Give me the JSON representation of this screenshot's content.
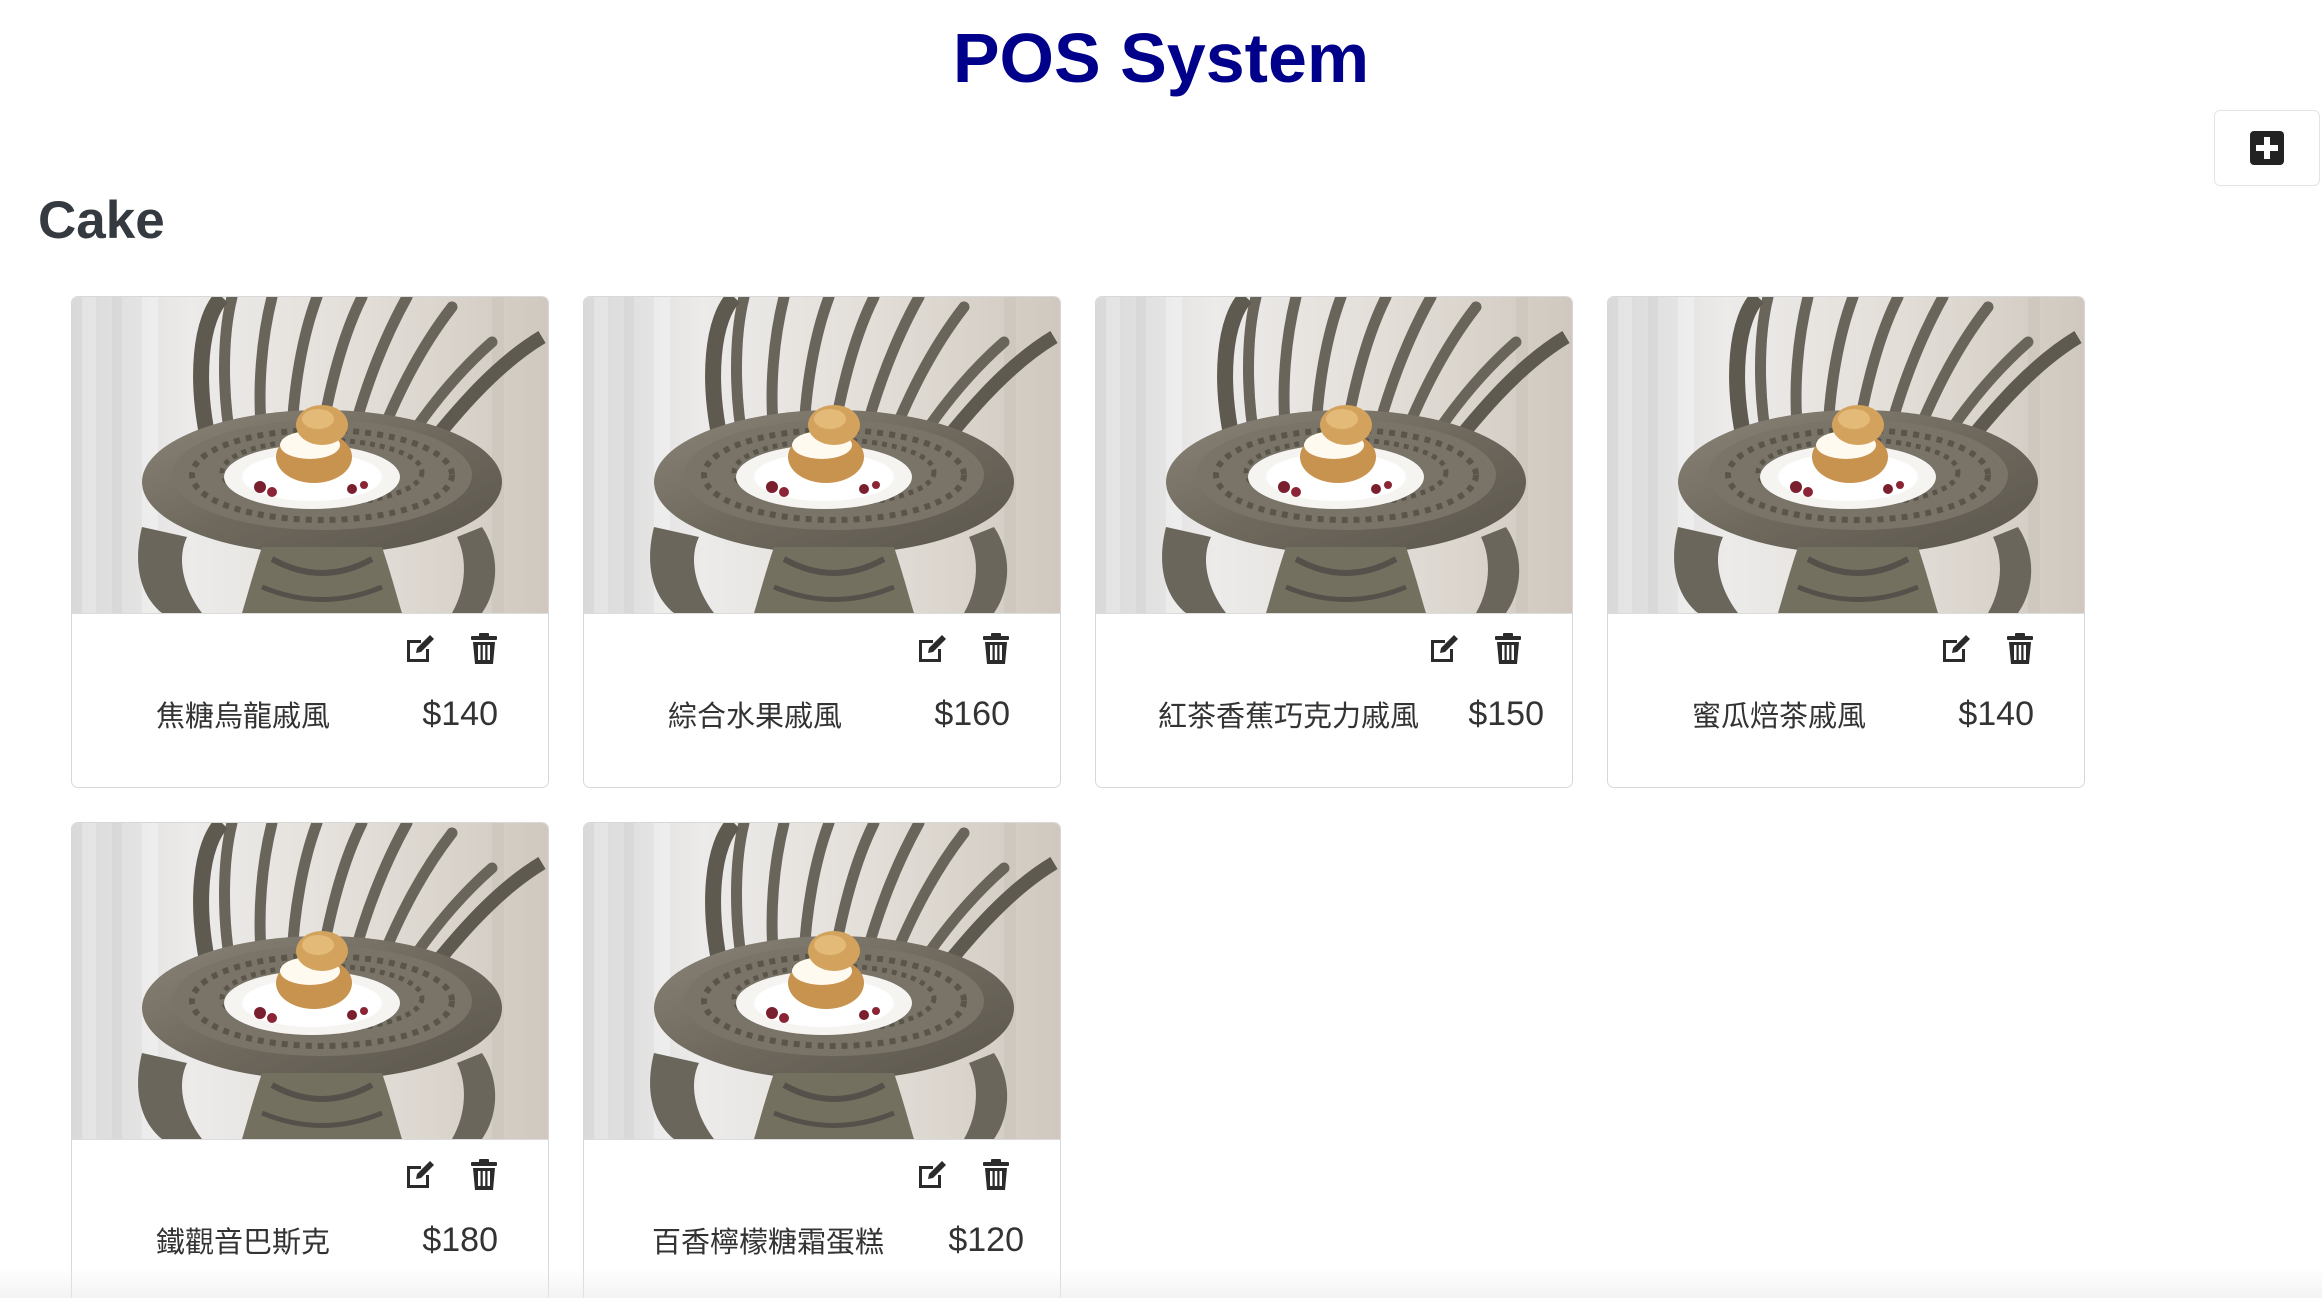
{
  "header": {
    "title": "POS System"
  },
  "toolbar": {
    "add_icon": "plus-square-icon"
  },
  "section": {
    "title": "Cake"
  },
  "colors": {
    "title": "#00008b",
    "text": "#333333",
    "heading": "#343a40",
    "border": "#d8d8d8"
  },
  "items": [
    {
      "name": "焦糖烏龍戚風",
      "price": "$140",
      "image": "cream-puff-on-iron-chair-photo",
      "edit_icon": "edit-icon",
      "delete_icon": "trash-icon"
    },
    {
      "name": "綜合水果戚風",
      "price": "$160",
      "image": "cream-puff-on-iron-chair-photo",
      "edit_icon": "edit-icon",
      "delete_icon": "trash-icon"
    },
    {
      "name": "紅茶香蕉巧克力戚風",
      "price": "$150",
      "image": "cream-puff-on-iron-chair-photo",
      "edit_icon": "edit-icon",
      "delete_icon": "trash-icon"
    },
    {
      "name": "蜜瓜焙茶戚風",
      "price": "$140",
      "image": "cream-puff-on-iron-chair-photo",
      "edit_icon": "edit-icon",
      "delete_icon": "trash-icon"
    },
    {
      "name": "鐵觀音巴斯克",
      "price": "$180",
      "image": "cream-puff-on-iron-chair-photo",
      "edit_icon": "edit-icon",
      "delete_icon": "trash-icon"
    },
    {
      "name": "百香檸檬糖霜蛋糕",
      "price": "$120",
      "image": "cream-puff-on-iron-chair-photo",
      "edit_icon": "edit-icon",
      "delete_icon": "trash-icon"
    }
  ]
}
